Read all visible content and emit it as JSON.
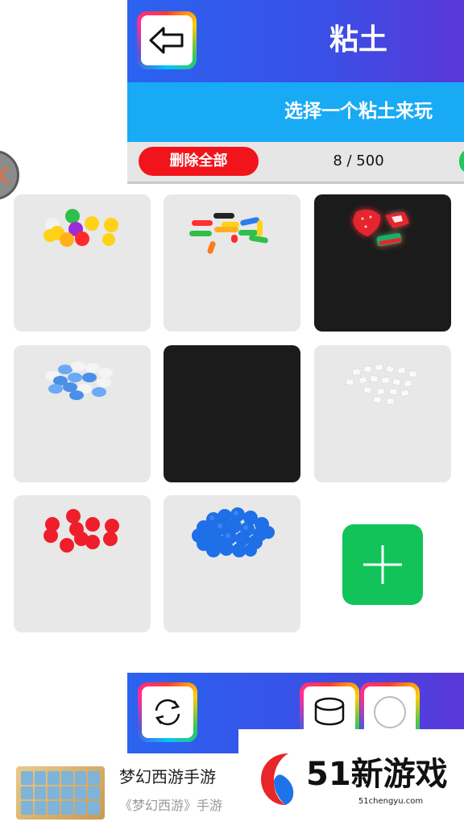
{
  "header": {
    "title": "粘土",
    "subtitle": "选择一个粘土来玩",
    "back_icon": "arrow-left-icon"
  },
  "toolbar": {
    "delete_all_label": "删除全部",
    "count": "8 / 500"
  },
  "colors": {
    "header_gradient": [
      "#2b63f0",
      "#5b36d8"
    ],
    "subtitle_bg": "#18aaf5",
    "delete_button": "#f2141b",
    "add_button": "#12c35a",
    "tile_bg": "#e8e8e8",
    "tile_dark_bg": "#1b1b1b"
  },
  "clay_tiles": [
    {
      "name": "colorful-balls"
    },
    {
      "name": "colorful-sticks"
    },
    {
      "name": "strawberry-candy"
    },
    {
      "name": "blue-white-chips"
    },
    {
      "name": "empty-black"
    },
    {
      "name": "white-flakes"
    },
    {
      "name": "red-balls"
    },
    {
      "name": "blue-balls"
    }
  ],
  "add_icon": "plus-icon",
  "bottom_bar": {
    "buttons": [
      "refresh-icon",
      "cylinder-icon",
      "circle-icon"
    ]
  },
  "ad": {
    "title": "梦幻西游手游",
    "description": "《梦幻西游》手游",
    "logo_text": "51新游戏",
    "logo_url": "51chengyu.com"
  }
}
